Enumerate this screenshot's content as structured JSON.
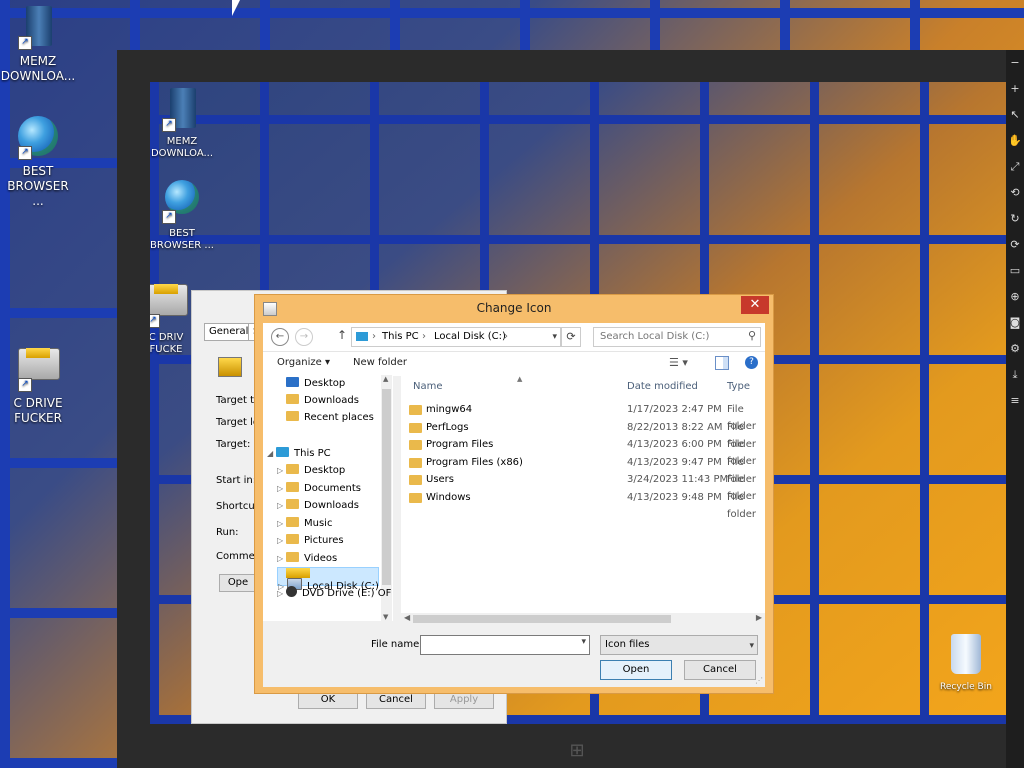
{
  "desktop": {
    "icons": [
      {
        "label": "MEMZ DOWNLOA..."
      },
      {
        "label": "BEST BROWSER ..."
      },
      {
        "label": "C DRIVE FUCKER"
      }
    ],
    "recycle_bin": "Recycle Bin"
  },
  "vm": {
    "icons": [
      {
        "label": "MEMZ DOWNLOA..."
      },
      {
        "label": "BEST BROWSER ..."
      },
      {
        "label": "C DRIV FUCKE"
      }
    ],
    "side_icons": [
      "−",
      "+",
      "↖",
      "✋",
      "⤢",
      "⟲",
      "↻",
      "⟳",
      "▭",
      "⊕",
      "◙",
      "⚙",
      "⤓",
      "≡"
    ]
  },
  "properties": {
    "tab_general": "General",
    "tab_second": "S",
    "labels": [
      "Target t",
      "Target lo",
      "Target:",
      "Start in:",
      "Shortcut",
      "Run:",
      "Commen"
    ],
    "open_button": "Ope",
    "ok": "OK",
    "cancel": "Cancel",
    "apply": "Apply"
  },
  "dialog": {
    "title": "Change Icon",
    "close": "✕",
    "back": "←",
    "forward": "→",
    "up": "↑",
    "breadcrumb": [
      "This PC",
      "Local Disk (C:)"
    ],
    "separator": "›",
    "search_placeholder": "Search Local Disk (C:)",
    "organize": "Organize ▾",
    "new_folder": "New folder",
    "nav": [
      {
        "label": "Desktop",
        "type": "desk",
        "level": 1
      },
      {
        "label": "Downloads",
        "type": "folder",
        "level": 1
      },
      {
        "label": "Recent places",
        "type": "folder",
        "level": 1
      },
      {
        "label": "This PC",
        "type": "pc",
        "level": 0
      },
      {
        "label": "Desktop",
        "type": "folder",
        "level": 1
      },
      {
        "label": "Documents",
        "type": "folder",
        "level": 1
      },
      {
        "label": "Downloads",
        "type": "folder",
        "level": 1
      },
      {
        "label": "Music",
        "type": "folder",
        "level": 1
      },
      {
        "label": "Pictures",
        "type": "folder",
        "level": 1
      },
      {
        "label": "Videos",
        "type": "folder",
        "level": 1
      },
      {
        "label": "Local Disk (C:)",
        "type": "drive",
        "level": 1,
        "selected": true
      },
      {
        "label": "DVD Drive (E:) OF",
        "type": "dvd",
        "level": 1
      }
    ],
    "columns": {
      "name": "Name",
      "date": "Date modified",
      "type": "Type"
    },
    "files": [
      {
        "name": "mingw64",
        "date": "1/17/2023 2:47 PM",
        "type": "File folder"
      },
      {
        "name": "PerfLogs",
        "date": "8/22/2013 8:22 AM",
        "type": "File folder"
      },
      {
        "name": "Program Files",
        "date": "4/13/2023 6:00 PM",
        "type": "File folder"
      },
      {
        "name": "Program Files (x86)",
        "date": "4/13/2023 9:47 PM",
        "type": "File folder"
      },
      {
        "name": "Users",
        "date": "3/24/2023 11:43 PM",
        "type": "File folder"
      },
      {
        "name": "Windows",
        "date": "4/13/2023 9:48 PM",
        "type": "File folder"
      }
    ],
    "file_name_label": "File name:",
    "file_name_value": "",
    "filter": "Icon files",
    "open": "Open",
    "cancel": "Cancel"
  }
}
